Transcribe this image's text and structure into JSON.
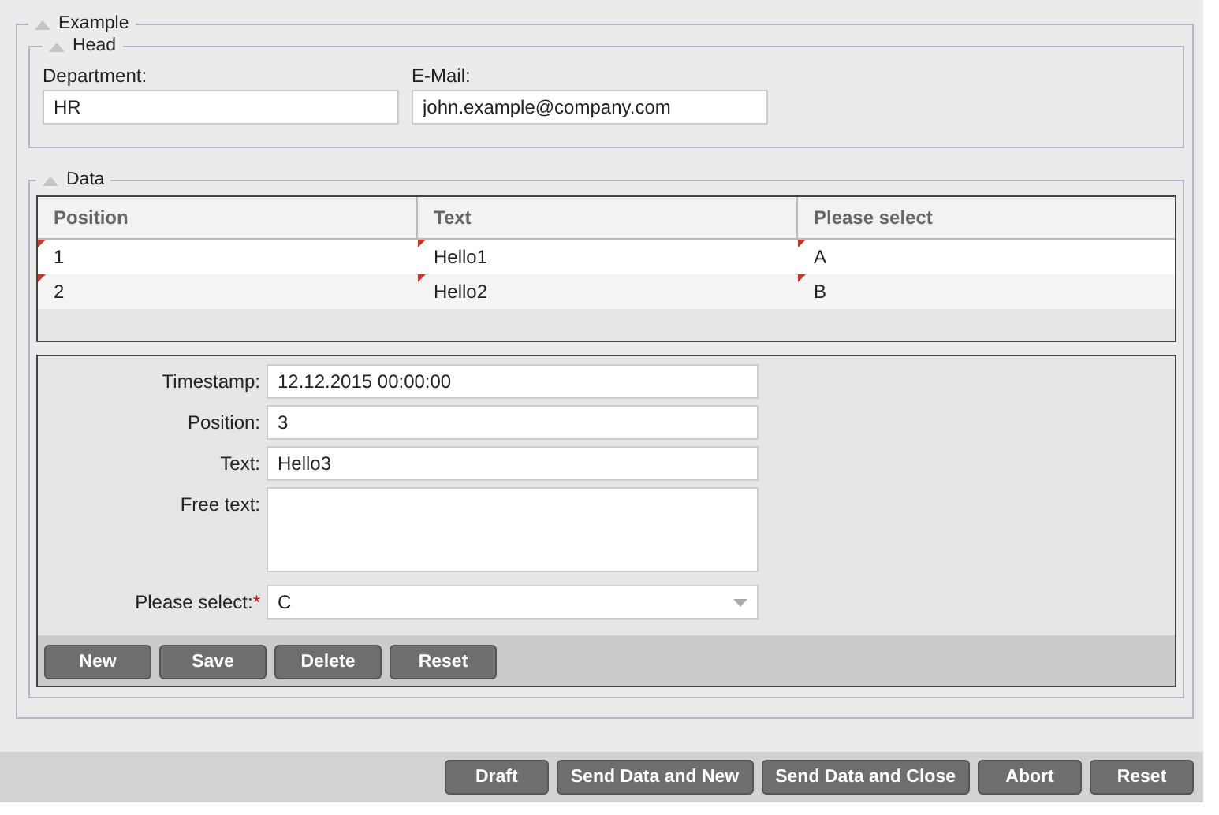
{
  "fieldset": {
    "legend": "Example",
    "expanded": true
  },
  "head": {
    "legend": "Head",
    "expanded": true,
    "fields": [
      {
        "label": "Department:",
        "value": "HR"
      },
      {
        "label": "E-Mail:",
        "value": "john.example@company.com"
      }
    ]
  },
  "data": {
    "legend": "Data",
    "expanded": true,
    "table": {
      "columns": [
        "Position",
        "Text",
        "Please select"
      ],
      "rows": [
        {
          "cells": [
            "1",
            "Hello1",
            "A"
          ],
          "modified": true
        },
        {
          "cells": [
            "2",
            "Hello2",
            "B"
          ],
          "modified": true
        }
      ]
    },
    "form": [
      {
        "kind": "input",
        "label": "Timestamp:",
        "value": "12.12.2015 00:00:00"
      },
      {
        "kind": "input",
        "label": "Position:",
        "value": "3"
      },
      {
        "kind": "input",
        "label": "Text:",
        "value": "Hello3"
      },
      {
        "kind": "textarea",
        "label": "Free text:"
      },
      {
        "kind": "select",
        "label": "Please select:",
        "value": "C",
        "required_mark": "*"
      }
    ],
    "buttons": [
      "New",
      "Save",
      "Delete",
      "Reset"
    ]
  },
  "footer_buttons": [
    "Draft",
    "Send Data and New",
    "Send Data and Close",
    "Abort",
    "Reset"
  ]
}
